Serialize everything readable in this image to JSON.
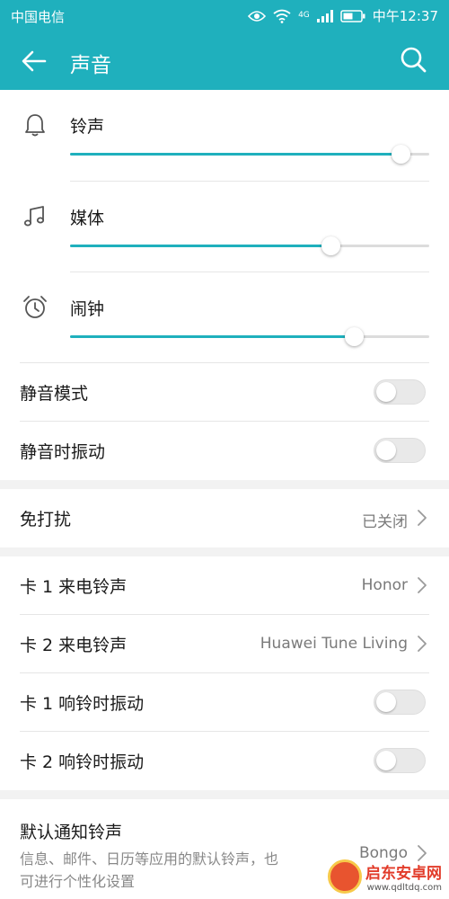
{
  "status_bar": {
    "carrier": "中国电信",
    "network": "4G",
    "time": "中午12:37"
  },
  "app_bar": {
    "title": "声音",
    "back_icon": "back-arrow-icon",
    "search_icon": "search-icon"
  },
  "volume": [
    {
      "label": "铃声",
      "icon": "bell-icon",
      "level": 0.92
    },
    {
      "label": "媒体",
      "icon": "music-note-icon",
      "level": 0.725
    },
    {
      "label": "闹钟",
      "icon": "alarm-clock-icon",
      "level": 0.79
    }
  ],
  "toggles_1": [
    {
      "label": "静音模式",
      "on": false
    },
    {
      "label": "静音时振动",
      "on": false
    }
  ],
  "dnd": {
    "label": "免打扰",
    "value": "已关闭"
  },
  "sim": {
    "ringtone_1": {
      "label": "卡 1 来电铃声",
      "value": "Honor"
    },
    "ringtone_2": {
      "label": "卡 2 来电铃声",
      "value": "Huawei Tune Living"
    },
    "vibrate_1": {
      "label": "卡 1 响铃时振动",
      "on": false
    },
    "vibrate_2": {
      "label": "卡 2 响铃时振动",
      "on": false
    }
  },
  "notification": {
    "label": "默认通知铃声",
    "sub": "信息、邮件、日历等应用的默认铃声，也可进行个性化设置",
    "value": "Bongo"
  },
  "watermark": {
    "line1": "启东安卓网",
    "line2": "www.qdltdq.com"
  },
  "colors": {
    "accent": "#1fb0bd",
    "background": "#f2f2f2",
    "card": "#ffffff"
  }
}
